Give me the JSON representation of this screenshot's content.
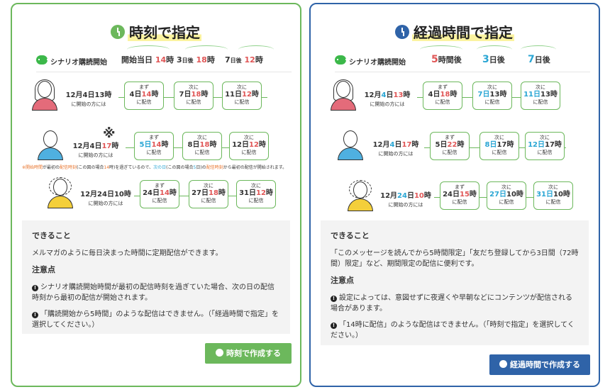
{
  "left": {
    "title": "時刻で指定",
    "header": {
      "start": "シナリオ購読開始",
      "t1a": "開始当日",
      "t1b": "14",
      "t1c": "時",
      "t2a": "3",
      "t2b": "日後",
      "t2c": "18",
      "t2d": "時",
      "t3a": "7",
      "t3b": "日後",
      "t3c": "12",
      "t3d": "時"
    },
    "rows": [
      {
        "date": "12月4日13時",
        "sub": "に開始の方には",
        "boxes": [
          {
            "top": "まず",
            "d": "4日",
            "h": "14",
            "u": "時",
            "bot": "に配信"
          },
          {
            "top": "次に",
            "d": "7日",
            "h": "18",
            "u": "時",
            "bot": "に配信"
          },
          {
            "top": "次に",
            "d": "11日",
            "h": "12",
            "u": "時",
            "bot": "に配信"
          }
        ]
      },
      {
        "date": "12月4日",
        "date_h": "17",
        "date_u": "時",
        "sub": "に開始の方には",
        "boxes": [
          {
            "top": "まず",
            "d": "5日",
            "h": "14",
            "u": "時",
            "bot": "に配信"
          },
          {
            "top": "次に",
            "d": "8日",
            "h": "18",
            "u": "時",
            "bot": "に配信"
          },
          {
            "top": "次に",
            "d": "12日",
            "h": "12",
            "u": "時",
            "bot": "に配信"
          }
        ]
      },
      {
        "date": "12月24日10時",
        "sub": "に開始の方には",
        "boxes": [
          {
            "top": "まず",
            "d": "24日",
            "h": "14",
            "u": "時",
            "bot": "に配信"
          },
          {
            "top": "次に",
            "d": "27日",
            "h": "18",
            "u": "時",
            "bot": "に配信"
          },
          {
            "top": "次に",
            "d": "31日",
            "h": "12",
            "u": "時",
            "bot": "に配信"
          }
        ]
      }
    ],
    "mark": "※",
    "note": {
      "a": "※開始時間",
      "b": "が最初の",
      "c": "配信時刻",
      "d": "(この図の場合",
      "e": "14",
      "f": "時)を過ぎているので、",
      "g": "次の日",
      "h": "(この図の場合",
      "i": "5",
      "j": "日)の",
      "k": "配信時刻",
      "l": "から最初の配信が開始されます。"
    },
    "can_title": "できること",
    "can_text": "メルマガのように毎日決まった時間に定期配信ができます。",
    "caution_title": "注意点",
    "caution1": "シナリオ購読開始時間が最初の配信時刻を過ぎていた場合、次の日の配信時刻から最初の配信が開始されます。",
    "caution2": "「購読開始から5時間」のような配信はできません。（「経過時間で指定」を選択してください。）",
    "button": "時刻で作成する"
  },
  "right": {
    "title": "経過時間で指定",
    "header": {
      "start": "シナリオ購読開始",
      "t1a": "5",
      "t1b": "時間後",
      "t2a": "3",
      "t2b": "日後",
      "t3a": "7",
      "t3b": "日後"
    },
    "rows": [
      {
        "date_a": "12月",
        "date_b": "4",
        "date_c": "日",
        "date_d": "13",
        "date_e": "時",
        "sub": "に開始の方には",
        "boxes": [
          {
            "top": "まず",
            "d": "4日",
            "h": "18",
            "u": "時",
            "bot": "に配信"
          },
          {
            "top": "次に",
            "d": "7日",
            "h": "13",
            "u": "時",
            "bot": "に配信"
          },
          {
            "top": "次に",
            "d": "11日",
            "h": "13",
            "u": "時",
            "bot": "に配信"
          }
        ]
      },
      {
        "date_a": "12月",
        "date_b": "4",
        "date_c": "日",
        "date_d": "17",
        "date_e": "時",
        "sub": "に開始の方には",
        "boxes": [
          {
            "top": "まず",
            "d": "5日",
            "h": "22",
            "u": "時",
            "bot": "に配信"
          },
          {
            "top": "次に",
            "d": "8日",
            "h": "17",
            "u": "時",
            "bot": "に配信"
          },
          {
            "top": "次に",
            "d": "12日",
            "h": "17",
            "u": "時",
            "bot": "に配信"
          }
        ]
      },
      {
        "date_a": "12月",
        "date_b": "24",
        "date_c": "日",
        "date_d": "10",
        "date_e": "時",
        "sub": "に開始の方には",
        "boxes": [
          {
            "top": "まず",
            "d": "24日",
            "h": "15",
            "u": "時",
            "bot": "に配信"
          },
          {
            "top": "次に",
            "d": "27日",
            "h": "10",
            "u": "時",
            "bot": "に配信"
          },
          {
            "top": "次に",
            "d": "31日",
            "h": "10",
            "u": "時",
            "bot": "に配信"
          }
        ]
      }
    ],
    "can_title": "できること",
    "can_text": "「このメッセージを読んでから5時間限定」「友だち登録してから3日間（72時間）限定」など、期間限定の配信に便利です。",
    "caution_title": "注意点",
    "caution1": "設定によっては、意図せずに夜遅くや早朝などにコンテンツが配信される場合があります。",
    "caution2": "「14時に配信」のような配信はできません。（「時刻で指定」を選択してください。）",
    "button": "経過時間で作成する"
  },
  "colors": {
    "green": "#6cb85c",
    "navy": "#2f63a8",
    "red": "#e05656",
    "blue": "#2aa6d4"
  }
}
